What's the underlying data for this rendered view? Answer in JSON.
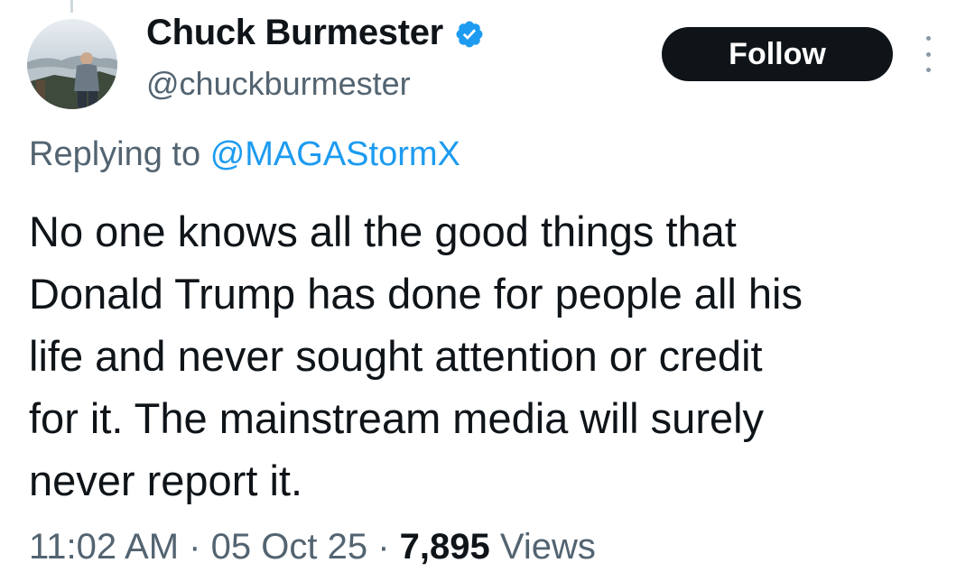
{
  "tweet": {
    "author": {
      "display_name": "Chuck Burmester",
      "handle": "@chuckburmester",
      "verified": true,
      "avatar_icon": "avatar-photo"
    },
    "follow_label": "Follow",
    "more_icon": "more-vertical-icon",
    "reply": {
      "prefix": "Replying to",
      "target": "@MAGAStormX"
    },
    "text": "No one knows all the good things that\nDonald Trump has done for people all his\nlife and never sought attention or credit\nfor it. The mainstream media will surely\nnever report it.",
    "meta": {
      "time": "11:02 AM",
      "separator": "·",
      "date": "05 Oct 25",
      "views_count": "7,895",
      "views_label": "Views"
    }
  },
  "colors": {
    "text_primary": "#0f1419",
    "text_secondary": "#536471",
    "link": "#1d9bf0",
    "verified_badge": "#1d9bf0",
    "follow_bg": "#0f1419"
  }
}
